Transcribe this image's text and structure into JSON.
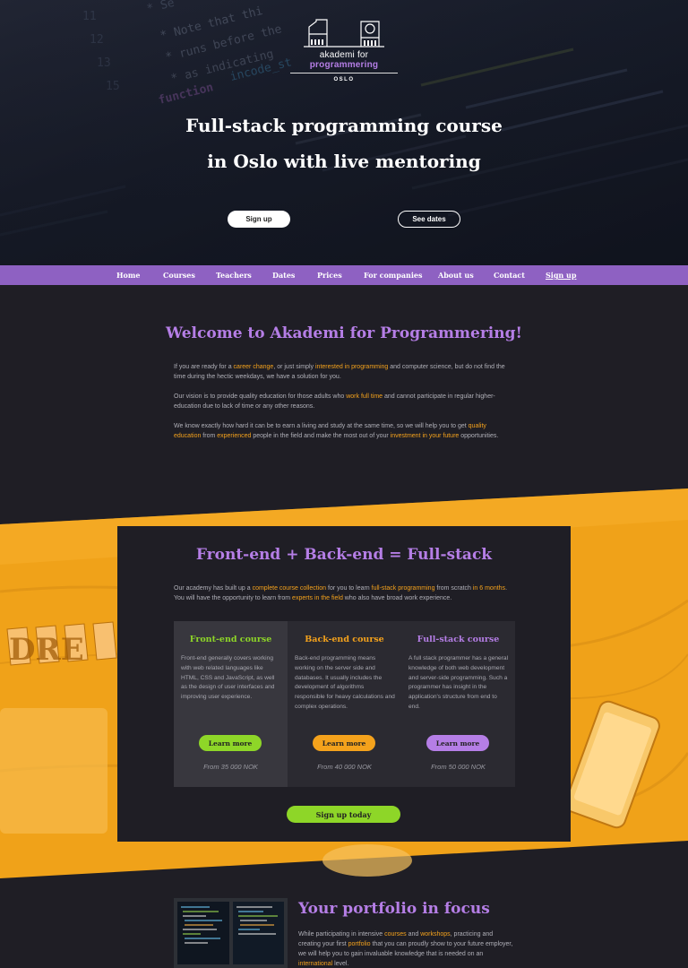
{
  "logo": {
    "prefix": "akademi for ",
    "accent": "programmering",
    "city": "OSLO"
  },
  "hero": {
    "title_line1": "Full-stack programming course",
    "title_line2": "in Oslo with live mentoring",
    "signup_label": "Sign up",
    "dates_label": "See dates"
  },
  "nav": {
    "items": [
      "Home",
      "Courses",
      "Teachers",
      "Dates",
      "Prices",
      "For companies",
      "About us",
      "Contact",
      "Sign up"
    ]
  },
  "welcome": {
    "title": "Welcome to Akademi for Programmering!",
    "p1": [
      {
        "t": "If you are ready for a "
      },
      {
        "t": "career change",
        "hl": true
      },
      {
        "t": ", or just simply "
      },
      {
        "t": "interested in programming",
        "hl": true
      },
      {
        "t": " and computer science, but do not find the time during the hectic weekdays, we have a solution for you."
      }
    ],
    "p2": [
      {
        "t": "Our vision is to provide quality education for those adults who "
      },
      {
        "t": "work full time",
        "hl": true
      },
      {
        "t": " and cannot participate in regular higher-education due to lack of time or any other reasons."
      }
    ],
    "p3": [
      {
        "t": "We know exactly how hard it can be to earn a living and study at the same time, so we will help you to get "
      },
      {
        "t": "quality education",
        "hl": true
      },
      {
        "t": " from "
      },
      {
        "t": "experienced",
        "hl": true
      },
      {
        "t": " people in the field and make the most out of your "
      },
      {
        "t": "investment in your future",
        "hl": true
      },
      {
        "t": " opportunities."
      }
    ]
  },
  "fullstack": {
    "title": "Front-end + Back-end = Full-stack",
    "intro": [
      {
        "t": "Our academy has built up a "
      },
      {
        "t": "complete course collection",
        "hl": true
      },
      {
        "t": " for you to learn "
      },
      {
        "t": "full-stack programming",
        "hl": true
      },
      {
        "t": " from scratch "
      },
      {
        "t": "in 6 months",
        "hl": true
      },
      {
        "t": ". You will have the opportunity to learn from "
      },
      {
        "t": "experts in the field",
        "hl": true
      },
      {
        "t": " who also have broad work experience."
      }
    ],
    "courses": [
      {
        "title": "Front-end course",
        "color": "#8ed628",
        "text": "Front-end generally covers working with web related languages like HTML, CSS and JavaScript, as well as the design of user interfaces and improving user experience.",
        "button": "Learn more",
        "price": "From 35 000 NOK"
      },
      {
        "title": "Back-end course",
        "color": "#f4a21c",
        "text": "Back-end programming means working on the server side and databases. It usually includes the development of algorithms responsible for heavy calculations and complex operations.",
        "button": "Learn more",
        "price": "From 40 000 NOK"
      },
      {
        "title": "Full-stack course",
        "color": "#b57ee6",
        "text": "A full stack programmer has a general knowledge of both web development and server-side programming. Such a programmer has insight in the application's structure from end to end.",
        "button": "Learn more",
        "price": "From 50 000 NOK"
      }
    ],
    "signup_label": "Sign up today"
  },
  "portfolio": {
    "title": "Your portfolio in focus",
    "text": [
      {
        "t": "While participating in intensive "
      },
      {
        "t": "courses",
        "hl": true
      },
      {
        "t": " and "
      },
      {
        "t": "workshops",
        "hl": true
      },
      {
        "t": ", practicing and creating your first "
      },
      {
        "t": "portfolio",
        "hl": true
      },
      {
        "t": " that you can proudly show to your future employer, we will help you to gain invaluable knowledge that is needed on an "
      },
      {
        "t": "international",
        "hl": true
      },
      {
        "t": " level."
      }
    ]
  },
  "colors": {
    "purple": "#8e61c2",
    "purple_text": "#b57ee6",
    "orange": "#f4a21c",
    "green": "#8ed628",
    "dark": "#1f1e25"
  }
}
